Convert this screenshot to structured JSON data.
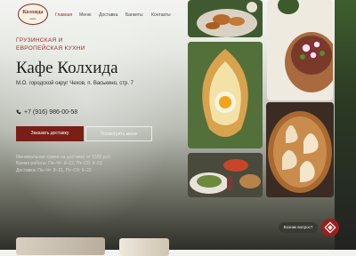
{
  "logo": {
    "name": "Колхида",
    "subtitle": "кафе"
  },
  "nav": {
    "items": [
      {
        "label": "Главная",
        "active": true
      },
      {
        "label": "Меню",
        "active": false
      },
      {
        "label": "Доставка",
        "active": false
      },
      {
        "label": "Банкеты",
        "active": false
      },
      {
        "label": "Контакты",
        "active": false
      }
    ]
  },
  "hero": {
    "cuisine_line1": "Грузинская и",
    "cuisine_line2": "европейская кухни",
    "title": "Кафе Колхида",
    "address": "М.О. городской округ Чехов, п. Васькино, стр. 7",
    "phone": "+7 (916) 986-00-58",
    "order_button": "Заказать доставку",
    "menu_button": "Посмотреть меню",
    "info_lines": [
      "Минимальная сумма на доставку от 1500 руб.",
      "Время работы: Пн–Чт: 9–22, Пт–Сб: 9–23",
      "Доставка: Пн–Чт: 9–21, Пт–Сб: 9–22"
    ]
  },
  "chat": {
    "label": "Возник вопрос?"
  },
  "colors": {
    "accent": "#9b2a22",
    "button": "#7a1f18"
  },
  "icons": [
    "phone-icon",
    "chat-icon"
  ]
}
